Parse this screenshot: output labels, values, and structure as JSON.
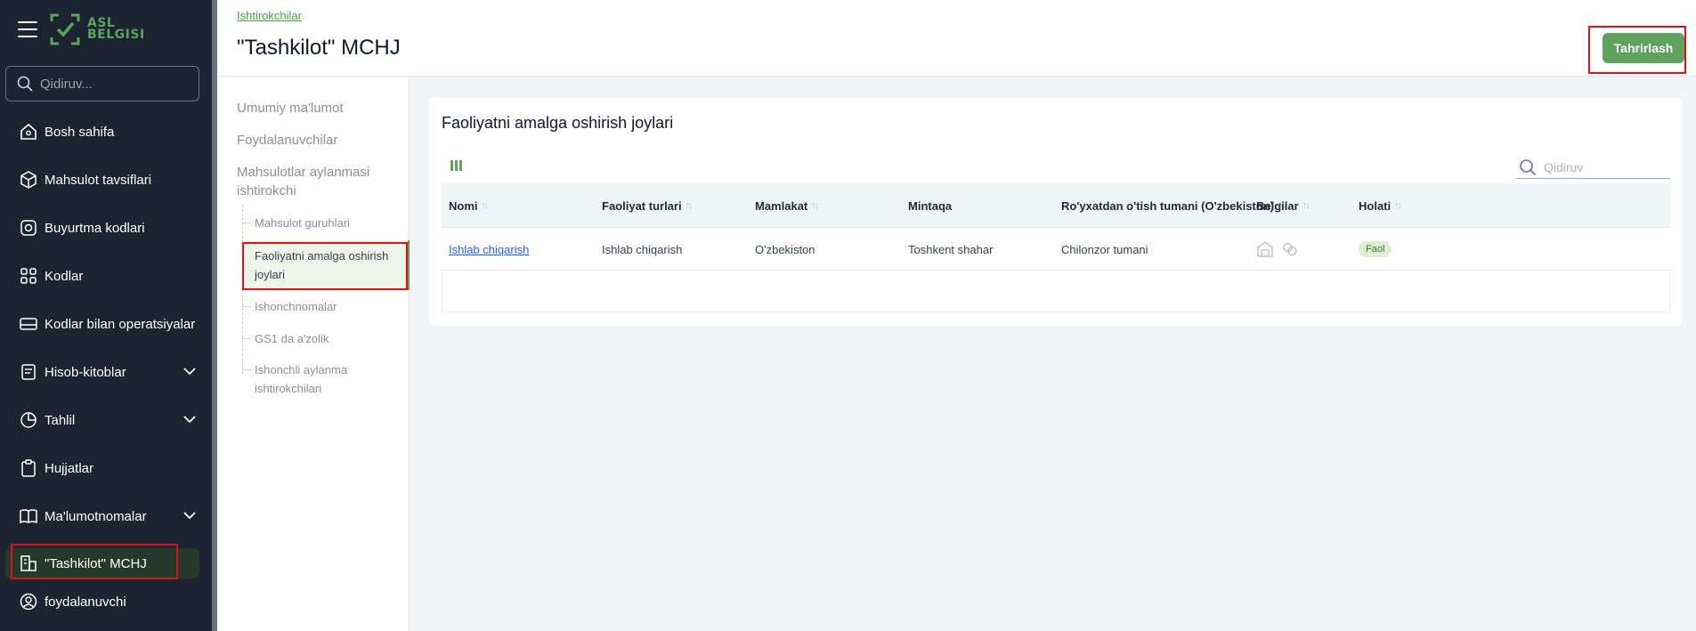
{
  "brand": {
    "line1": "ASL",
    "line2": "BELGISI",
    "color": "#5aa55a"
  },
  "sidebar": {
    "search_placeholder": "Qidiruv...",
    "items": [
      {
        "label": "Bosh sahifa",
        "icon": "home-icon"
      },
      {
        "label": "Mahsulot tavsiflari",
        "icon": "cube-icon"
      },
      {
        "label": "Buyurtma kodlari",
        "icon": "qr-order-icon"
      },
      {
        "label": "Kodlar",
        "icon": "codes-icon"
      },
      {
        "label": "Kodlar bilan operatsiyalar",
        "icon": "card-icon"
      },
      {
        "label": "Hisob-kitoblar",
        "icon": "receipt-icon",
        "expandable": true
      },
      {
        "label": "Tahlil",
        "icon": "chart-icon",
        "expandable": true
      },
      {
        "label": "Hujjatlar",
        "icon": "clipboard-icon"
      },
      {
        "label": "Ma'lumotnomalar",
        "icon": "book-icon",
        "expandable": true
      },
      {
        "label": "\"Tashkilot\" MCHJ",
        "icon": "building-icon",
        "active": true
      },
      {
        "label": "foydalanuvchi",
        "icon": "user-icon"
      }
    ]
  },
  "header": {
    "breadcrumb": "Ishtirokchilar",
    "title": "\"Tashkilot\" MCHJ",
    "edit_label": "Tahrirlash"
  },
  "subnav": {
    "top": [
      "Umumiy ma'lumot",
      "Foydalanuvchilar",
      "Mahsulotlar aylanmasi ishtirokchi"
    ],
    "children": [
      "Mahsulot guruhlari",
      "Faoliyatni amalga oshirish joylari",
      "Ishonchnomalar",
      "GS1 da a'zolik",
      "Ishonchli aylanma ishtirokchilari"
    ],
    "active_child": 1
  },
  "card": {
    "title": "Faoliyatni amalga oshirish joylari",
    "search_placeholder": "Qidiruv",
    "columns": [
      "Nomi",
      "Faoliyat turlari",
      "Mamlakat",
      "Mintaqa",
      "Ro'yxatdan o'tish tumani (O'zbekiston)",
      "Belgilar",
      "Holati"
    ],
    "rows": [
      {
        "name": "Ishlab chiqarish",
        "activity": "Ishlab chiqarish",
        "country": "O'zbekiston",
        "region": "Toshkent shahar",
        "district": "Chilonzor tumani",
        "marks": [
          "warehouse-icon",
          "link-icon"
        ],
        "status": "Faol"
      }
    ]
  },
  "colors": {
    "accent": "#5ea25e",
    "sidebar_bg": "#1c2431",
    "highlight": "#e0101a"
  }
}
